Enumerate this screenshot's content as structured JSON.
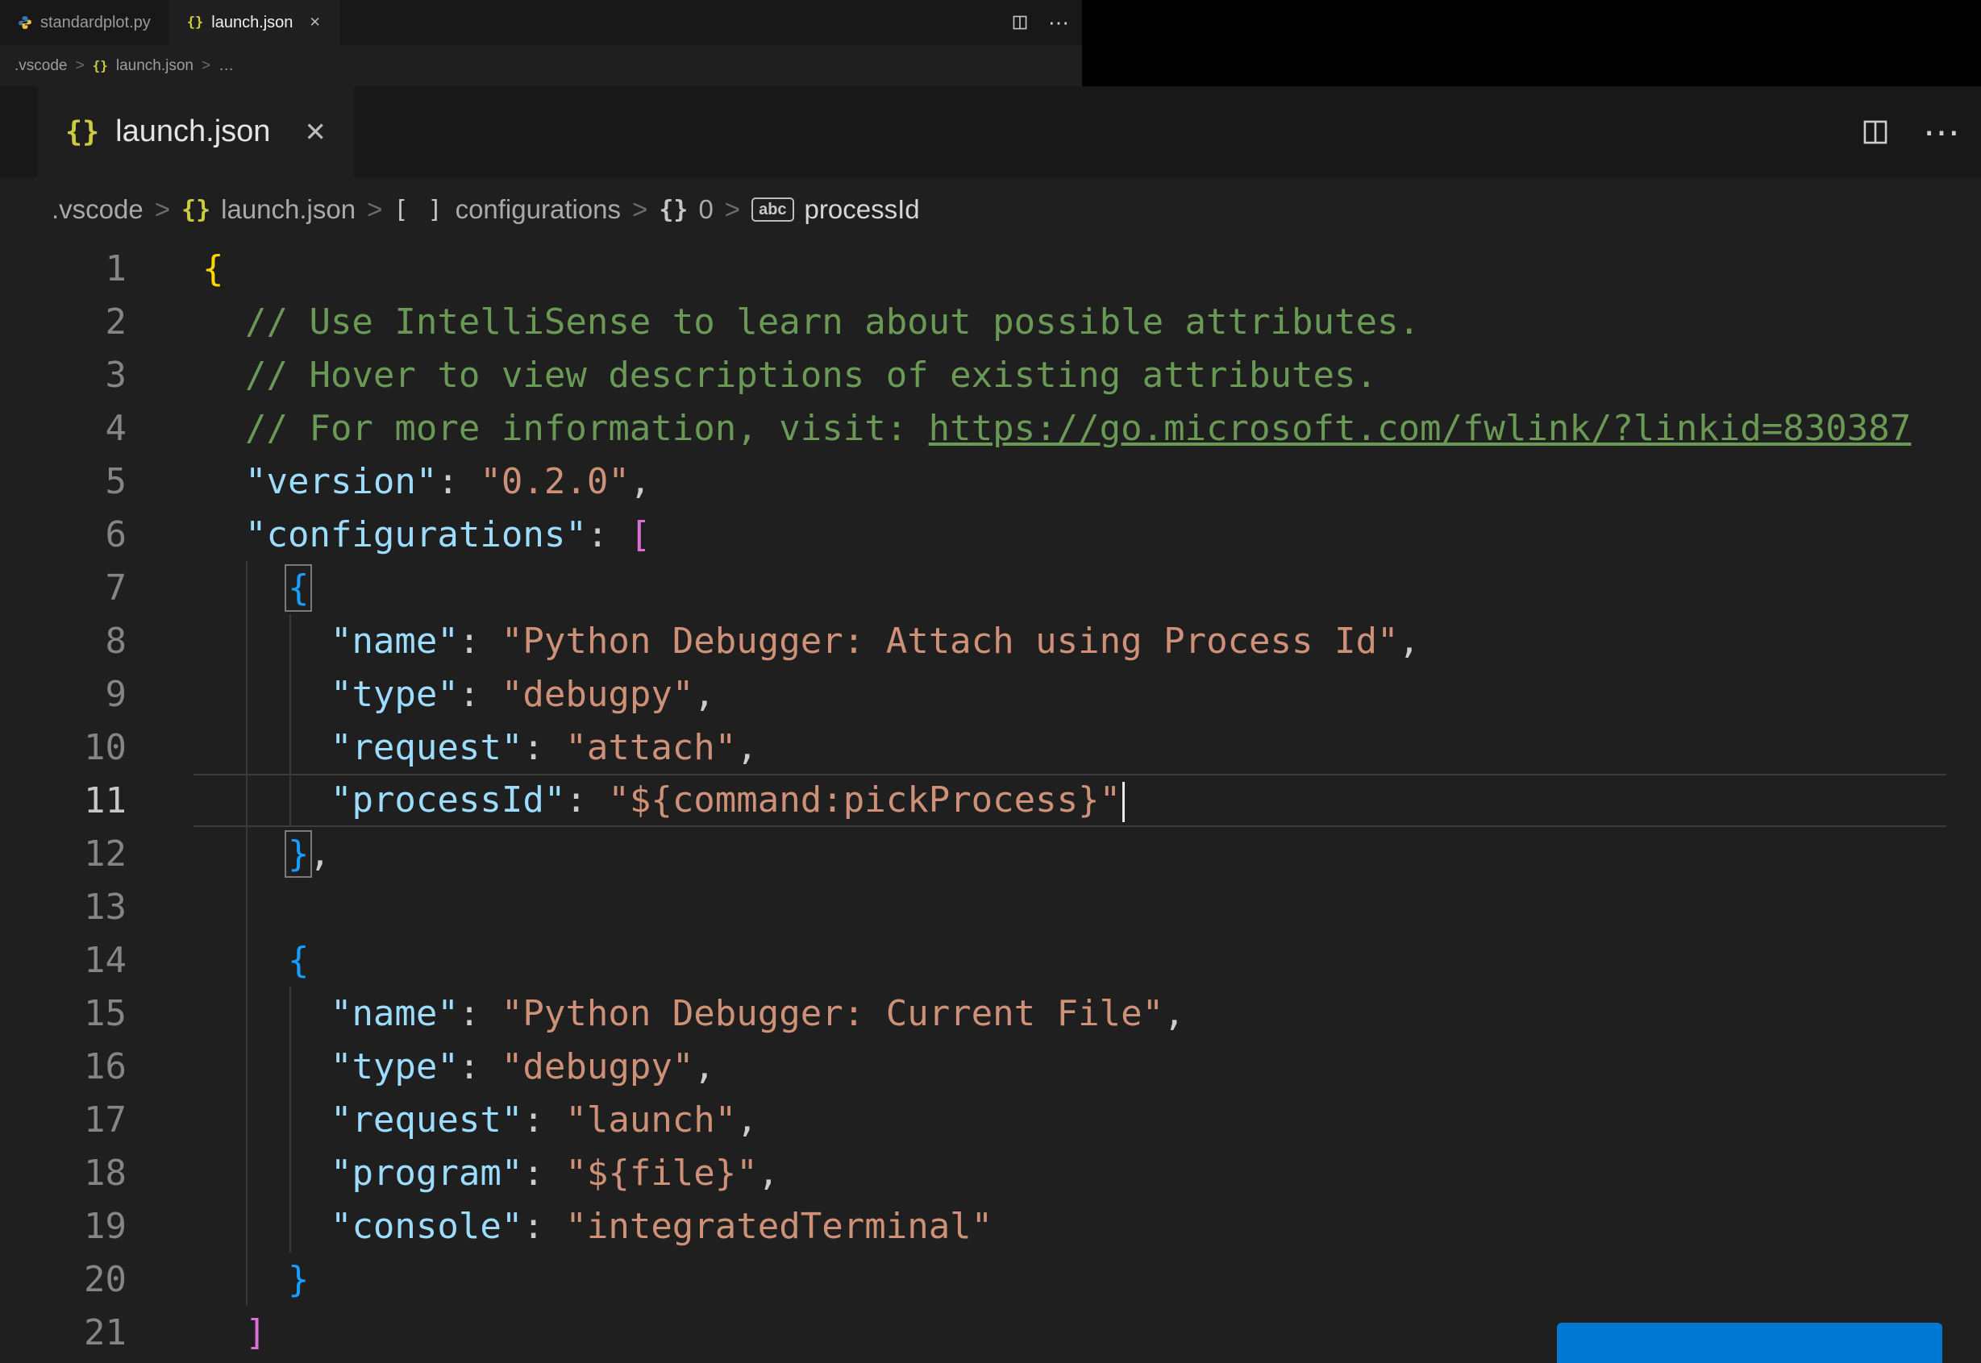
{
  "colors": {
    "editor_background": "#1f1f1f",
    "tabbar_background": "#181818",
    "comment": "#6a9955",
    "link": "#6a9955",
    "property": "#9cdcfe",
    "string": "#ce9178",
    "punctuation": "#cccccc",
    "bracket1": "#ffd700",
    "bracket2": "#da70d6",
    "bracket3": "#179fff",
    "json_icon": "#cbcb41",
    "button_accent": "#0078d4"
  },
  "icons": {
    "braces": "{}",
    "array": "[ ]",
    "string_symbol": "abc",
    "close": "✕",
    "more": "⋯",
    "chevron": ">",
    "ellipsis": "…"
  },
  "mini_window": {
    "tabs": [
      {
        "label": "standardplot.py"
      },
      {
        "label": "launch.json"
      }
    ],
    "breadcrumb": {
      "folder": ".vscode",
      "file": "launch.json",
      "more": "…"
    }
  },
  "editor": {
    "tab_label": "launch.json",
    "breadcrumbs": {
      "folder": ".vscode",
      "file": "launch.json",
      "array_item": "configurations",
      "index": "0",
      "symbol": "processId"
    }
  },
  "code": {
    "lines": [
      {
        "num": 1,
        "indent": 0,
        "tokens": [
          {
            "text": "{",
            "color": "bracket1"
          }
        ]
      },
      {
        "num": 2,
        "indent": 2,
        "tokens": [
          {
            "text": "// Use IntelliSense to learn about possible attributes.",
            "color": "comment"
          }
        ]
      },
      {
        "num": 3,
        "indent": 2,
        "tokens": [
          {
            "text": "// Hover to view descriptions of existing attributes.",
            "color": "comment"
          }
        ]
      },
      {
        "num": 4,
        "indent": 2,
        "tokens": [
          {
            "text": "// For more information, visit: ",
            "color": "comment"
          },
          {
            "text": "https://go.microsoft.com/fwlink/?linkid=830387",
            "color": "link",
            "underline": true
          }
        ]
      },
      {
        "num": 5,
        "indent": 2,
        "tokens": [
          {
            "text": "\"version\"",
            "color": "property"
          },
          {
            "text": ": ",
            "color": "punctuation"
          },
          {
            "text": "\"0.2.0\"",
            "color": "string"
          },
          {
            "text": ",",
            "color": "punctuation"
          }
        ]
      },
      {
        "num": 6,
        "indent": 2,
        "tokens": [
          {
            "text": "\"configurations\"",
            "color": "property"
          },
          {
            "text": ": ",
            "color": "punctuation"
          },
          {
            "text": "[",
            "color": "bracket2"
          }
        ]
      },
      {
        "num": 7,
        "indent": 4,
        "tokens": [
          {
            "text": "{",
            "color": "bracket3",
            "boxed": true
          }
        ]
      },
      {
        "num": 8,
        "indent": 6,
        "tokens": [
          {
            "text": "\"name\"",
            "color": "property"
          },
          {
            "text": ": ",
            "color": "punctuation"
          },
          {
            "text": "\"Python Debugger: Attach using Process Id\"",
            "color": "string"
          },
          {
            "text": ",",
            "color": "punctuation"
          }
        ]
      },
      {
        "num": 9,
        "indent": 6,
        "tokens": [
          {
            "text": "\"type\"",
            "color": "property"
          },
          {
            "text": ": ",
            "color": "punctuation"
          },
          {
            "text": "\"debugpy\"",
            "color": "string"
          },
          {
            "text": ",",
            "color": "punctuation"
          }
        ]
      },
      {
        "num": 10,
        "indent": 6,
        "tokens": [
          {
            "text": "\"request\"",
            "color": "property"
          },
          {
            "text": ": ",
            "color": "punctuation"
          },
          {
            "text": "\"attach\"",
            "color": "string"
          },
          {
            "text": ",",
            "color": "punctuation"
          }
        ]
      },
      {
        "num": 11,
        "indent": 6,
        "current": true,
        "cursor": true,
        "tokens": [
          {
            "text": "\"processId\"",
            "color": "property"
          },
          {
            "text": ": ",
            "color": "punctuation"
          },
          {
            "text": "\"${command:pickProcess}\"",
            "color": "string"
          }
        ]
      },
      {
        "num": 12,
        "indent": 4,
        "tokens": [
          {
            "text": "}",
            "color": "bracket3",
            "boxed": true
          },
          {
            "text": ",",
            "color": "punctuation"
          }
        ]
      },
      {
        "num": 13,
        "indent": 0,
        "tokens": []
      },
      {
        "num": 14,
        "indent": 4,
        "tokens": [
          {
            "text": "{",
            "color": "bracket3"
          }
        ]
      },
      {
        "num": 15,
        "indent": 6,
        "tokens": [
          {
            "text": "\"name\"",
            "color": "property"
          },
          {
            "text": ": ",
            "color": "punctuation"
          },
          {
            "text": "\"Python Debugger: Current File\"",
            "color": "string"
          },
          {
            "text": ",",
            "color": "punctuation"
          }
        ]
      },
      {
        "num": 16,
        "indent": 6,
        "tokens": [
          {
            "text": "\"type\"",
            "color": "property"
          },
          {
            "text": ": ",
            "color": "punctuation"
          },
          {
            "text": "\"debugpy\"",
            "color": "string"
          },
          {
            "text": ",",
            "color": "punctuation"
          }
        ]
      },
      {
        "num": 17,
        "indent": 6,
        "tokens": [
          {
            "text": "\"request\"",
            "color": "property"
          },
          {
            "text": ": ",
            "color": "punctuation"
          },
          {
            "text": "\"launch\"",
            "color": "string"
          },
          {
            "text": ",",
            "color": "punctuation"
          }
        ]
      },
      {
        "num": 18,
        "indent": 6,
        "tokens": [
          {
            "text": "\"program\"",
            "color": "property"
          },
          {
            "text": ": ",
            "color": "punctuation"
          },
          {
            "text": "\"${file}\"",
            "color": "string"
          },
          {
            "text": ",",
            "color": "punctuation"
          }
        ]
      },
      {
        "num": 19,
        "indent": 6,
        "tokens": [
          {
            "text": "\"console\"",
            "color": "property"
          },
          {
            "text": ": ",
            "color": "punctuation"
          },
          {
            "text": "\"integratedTerminal\"",
            "color": "string"
          }
        ]
      },
      {
        "num": 20,
        "indent": 4,
        "tokens": [
          {
            "text": "}",
            "color": "bracket3"
          }
        ]
      },
      {
        "num": 21,
        "indent": 2,
        "tokens": [
          {
            "text": "]",
            "color": "bracket2"
          }
        ]
      }
    ]
  }
}
